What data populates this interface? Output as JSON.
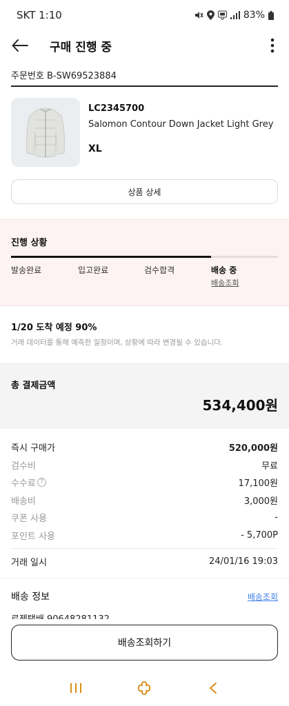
{
  "status_bar": {
    "carrier_time": "SKT 1:10",
    "battery": "83%"
  },
  "header": {
    "title": "구매 진행 중"
  },
  "order": {
    "number": "주문번호 B-SW69523884"
  },
  "product": {
    "code": "LC2345700",
    "name": "Salomon Contour Down Jacket Light Grey",
    "size": "XL",
    "detail_button": "상품 상세"
  },
  "progress": {
    "title": "진행 상황",
    "steps": [
      "발송완료",
      "입고완료",
      "검수합격",
      "배송 중"
    ],
    "current_step_index": 3,
    "fill_fraction": 0.75,
    "tracking_link": "배송조회"
  },
  "arrival": {
    "title": "1/20 도착 예정 90%",
    "note": "거래 데이터를 통해 예측한 일정이며, 상황에 따라 변경될 수 있습니다."
  },
  "total": {
    "label": "총 결제금액",
    "value": "534,400원"
  },
  "payment": {
    "rows": [
      {
        "label": "즉시 구매가",
        "value": "520,000원"
      },
      {
        "label": "검수비",
        "value": "무료"
      },
      {
        "label": "수수료",
        "value": "17,100원"
      },
      {
        "label": "배송비",
        "value": "3,000원"
      },
      {
        "label": "쿠폰 사용",
        "value": "-"
      },
      {
        "label": "포인트 사용",
        "value": "- 5,700P"
      }
    ],
    "help_glyph": "?"
  },
  "trade": {
    "label": "거래 일시",
    "value": "24/01/16 19:03"
  },
  "shipping": {
    "title": "배송 정보",
    "link": "배송조회",
    "tracking_partial": "로젠택배 90648281132"
  },
  "cta": {
    "label": "배송조회하기"
  },
  "icons": {
    "back": "arrow-left-icon",
    "more": "more-vertical-icon",
    "nav_recent": "recent-apps-icon",
    "nav_home": "home-icon",
    "nav_back": "nav-back-icon"
  },
  "colors": {
    "progress_bg": "#fdf3f2",
    "link_blue": "#3b7de9",
    "nav_accent": "#d98a12"
  }
}
